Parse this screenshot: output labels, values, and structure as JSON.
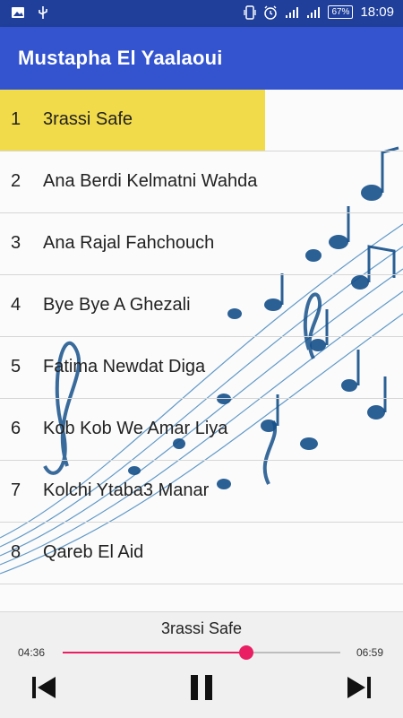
{
  "status_bar": {
    "battery": "67%",
    "time": "18:09"
  },
  "app_bar": {
    "title": "Mustapha El Yaalaoui"
  },
  "tracks": [
    {
      "num": "1",
      "title": "3rassi Safe"
    },
    {
      "num": "2",
      "title": "Ana Berdi Kelmatni Wahda"
    },
    {
      "num": "3",
      "title": "Ana Rajal Fahchouch"
    },
    {
      "num": "4",
      "title": "Bye Bye A Ghezali"
    },
    {
      "num": "5",
      "title": "Fatima Newdat Diga"
    },
    {
      "num": "6",
      "title": "Kob Kob We Amar Liya"
    },
    {
      "num": "7",
      "title": "Kolchi Ytaba3 Manar"
    },
    {
      "num": "8",
      "title": "Qareb El Aid"
    }
  ],
  "selected_track": 0,
  "player": {
    "now_playing": "3rassi Safe",
    "elapsed": "04:36",
    "total": "06:59",
    "progress": 0.66
  },
  "icons": {
    "status_left": [
      "image-icon",
      "usb-icon"
    ],
    "status_right": [
      "vibrate-icon",
      "alarm-icon",
      "signal-icon",
      "signal-icon",
      "battery-icon"
    ],
    "controls": [
      "skip-previous-icon",
      "pause-icon",
      "skip-next-icon"
    ]
  },
  "colors": {
    "status_bar": "#1f3f9a",
    "app_bar": "#3353cf",
    "highlight": "#f2db4a",
    "accent": "#e91e63"
  }
}
